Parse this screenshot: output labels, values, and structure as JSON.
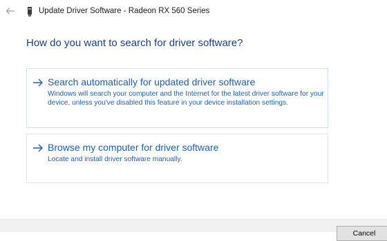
{
  "window": {
    "title": "Update Driver Software - Radeon RX 560 Series",
    "back_icon": "back-arrow-icon",
    "device_icon": "display-adapter-icon"
  },
  "main": {
    "question": "How do you want to search for driver software?",
    "options": [
      {
        "title": "Search automatically for updated driver software",
        "description": "Windows will search your computer and the Internet for the latest driver software for your device, unless you've disabled this feature in your device installation settings.",
        "icon": "arrow-right-icon"
      },
      {
        "title": "Browse my computer for driver software",
        "description": "Locate and install driver software manually.",
        "icon": "arrow-right-icon"
      }
    ]
  },
  "footer": {
    "cancel_label": "Cancel"
  },
  "colors": {
    "link": "#1a5fb4",
    "heading": "#1b3d8f",
    "option_border": "#d7e4f1"
  }
}
